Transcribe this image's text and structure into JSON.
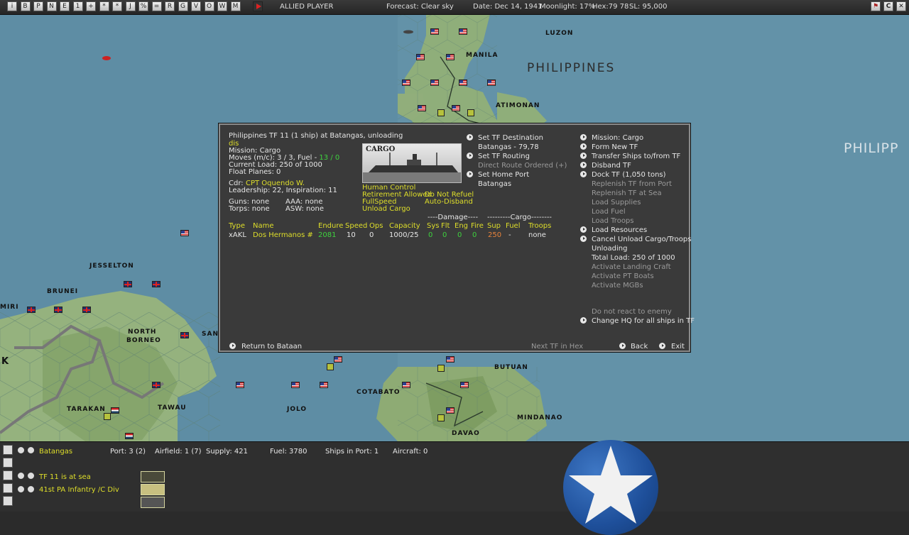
{
  "topbar": {
    "side": "ALLIED PLAYER",
    "forecast": "Forecast: Clear sky",
    "date": "Date: Dec 14, 1941",
    "moonlight": "Moonlight: 17%",
    "hex": "Hex:79 78",
    "sl": "SL: 95,000",
    "icons": [
      "i",
      "B",
      "P",
      "N",
      "E",
      "1",
      "+",
      "*",
      "*",
      "J",
      "%",
      "=",
      "R",
      "G",
      "V",
      "O",
      "W",
      "M"
    ]
  },
  "map": {
    "labels": {
      "luzon": "LUZON",
      "manila": "MANILA",
      "philippines": "PHILIPPINES",
      "philipp": "PHILIPP",
      "atimonan": "ATIMONAN",
      "jesselton": "JESSELTON",
      "brunei": "BRUNEI",
      "miri": "MIRI",
      "north_borneo_1": "NORTH",
      "north_borneo_2": "BORNEO",
      "sand": "SAND",
      "k": "K",
      "tarakan": "TARAKAN",
      "tawau": "TAWAU",
      "jolo": "JOLO",
      "cotabato": "COTABATO",
      "butuan": "BUTUAN",
      "mindanao": "MINDANAO",
      "davao": "DAVAO"
    }
  },
  "dialog": {
    "title": "Philippines TF 11 (1 ship) at Batangas, unloading",
    "dis": "dis",
    "mission": "Mission: Cargo",
    "moves_label": "Moves (m/c): 3 / 3, Fuel - ",
    "moves_fuel": "13 / 0",
    "current_load": "Current Load: 250 of 1000",
    "float_planes": "Float Planes: 0",
    "cdr_label": "Cdr:",
    "cdr_name": "CPT Oquendo W.",
    "leadership": "Leadership: 22, Inspiration: 11",
    "guns": "Guns: none",
    "aaa": "AAA: none",
    "torps": "Torps: none",
    "asw": "ASW: none",
    "ship_image_label": "CARGO",
    "settings": {
      "human_control": "Human Control",
      "retirement": "Retirement Allowed",
      "do_not_refuel": "Do Not Refuel",
      "full_speed": "FullSpeed",
      "auto_disband": "Auto-Disband",
      "unload_cargo": "Unload Cargo"
    },
    "middle_actions": {
      "set_destination": "Set TF Destination",
      "destination_value": "Batangas - 79,78",
      "set_routing": "Set TF Routing",
      "direct_route": "Direct Route Ordered (+)",
      "set_home_port": "Set Home Port",
      "home_port_value": "Batangas"
    },
    "right_actions": [
      {
        "label": "Mission: Cargo",
        "enabled": true,
        "arrow": true
      },
      {
        "label": "Form New TF",
        "enabled": true,
        "arrow": true
      },
      {
        "label": "Transfer Ships to/from TF",
        "enabled": true,
        "arrow": true
      },
      {
        "label": "Disband TF",
        "enabled": true,
        "arrow": true
      },
      {
        "label": "Dock TF (1,050 tons)",
        "enabled": true,
        "arrow": true
      },
      {
        "label": "Replenish TF from Port",
        "enabled": false,
        "arrow": false
      },
      {
        "label": "Replenish TF at Sea",
        "enabled": false,
        "arrow": false
      },
      {
        "label": "Load Supplies",
        "enabled": false,
        "arrow": false
      },
      {
        "label": "Load Fuel",
        "enabled": false,
        "arrow": false
      },
      {
        "label": "Load Troops",
        "enabled": false,
        "arrow": false
      },
      {
        "label": "Load Resources",
        "enabled": true,
        "arrow": true
      },
      {
        "label": "Cancel Unload Cargo/Troops",
        "enabled": true,
        "arrow": true
      },
      {
        "label": "Unloading",
        "enabled": true,
        "arrow": false
      },
      {
        "label": "Total Load: 250 of 1000",
        "enabled": true,
        "arrow": false
      },
      {
        "label": "Activate Landing Craft",
        "enabled": false,
        "arrow": false
      },
      {
        "label": "Activate PT Boats",
        "enabled": false,
        "arrow": false
      },
      {
        "label": "Activate MGBs",
        "enabled": false,
        "arrow": false
      }
    ],
    "do_not_react": "Do not react to enemy",
    "change_hq": "Change HQ for all ships in TF",
    "group_damage": "----Damage----",
    "group_cargo": "---------Cargo--------",
    "table": {
      "headers": {
        "type": "Type",
        "name": "Name",
        "endure": "Endure",
        "speed": "Speed",
        "ops": "Ops",
        "capacity": "Capacity",
        "sys": "Sys",
        "flt": "Flt",
        "eng": "Eng",
        "fire": "Fire",
        "sup": "Sup",
        "fuel": "Fuel",
        "troops": "Troops"
      },
      "row": {
        "type": "xAKL",
        "name": "Dos Hermanos #",
        "endure": "2081",
        "speed": "10",
        "ops": "0",
        "capacity": "1000/25",
        "sys": "0",
        "flt": "0",
        "eng": "0",
        "fire": "0",
        "sup": "250",
        "fuel": "-",
        "troops": "none"
      }
    },
    "footer": {
      "return": "Return to Bataan",
      "next_tf": "Next TF in Hex",
      "back": "Back",
      "exit": "Exit"
    }
  },
  "bottom": {
    "location": "Batangas",
    "port": "Port: 3 (2)",
    "airfield": "Airfield: 1 (7)",
    "supply": "Supply: 421",
    "fuel": "Fuel: 3780",
    "ships_in_port": "Ships in Port: 1",
    "aircraft": "Aircraft: 0",
    "tf": "TF 11 is at sea",
    "unit": "41st PA Infantry /C Div"
  },
  "colors": {
    "accent_yellow": "#dede2a",
    "value_green": "#3ed23e",
    "sup_orange": "#e8833a",
    "panel": "#3a3a3a"
  }
}
